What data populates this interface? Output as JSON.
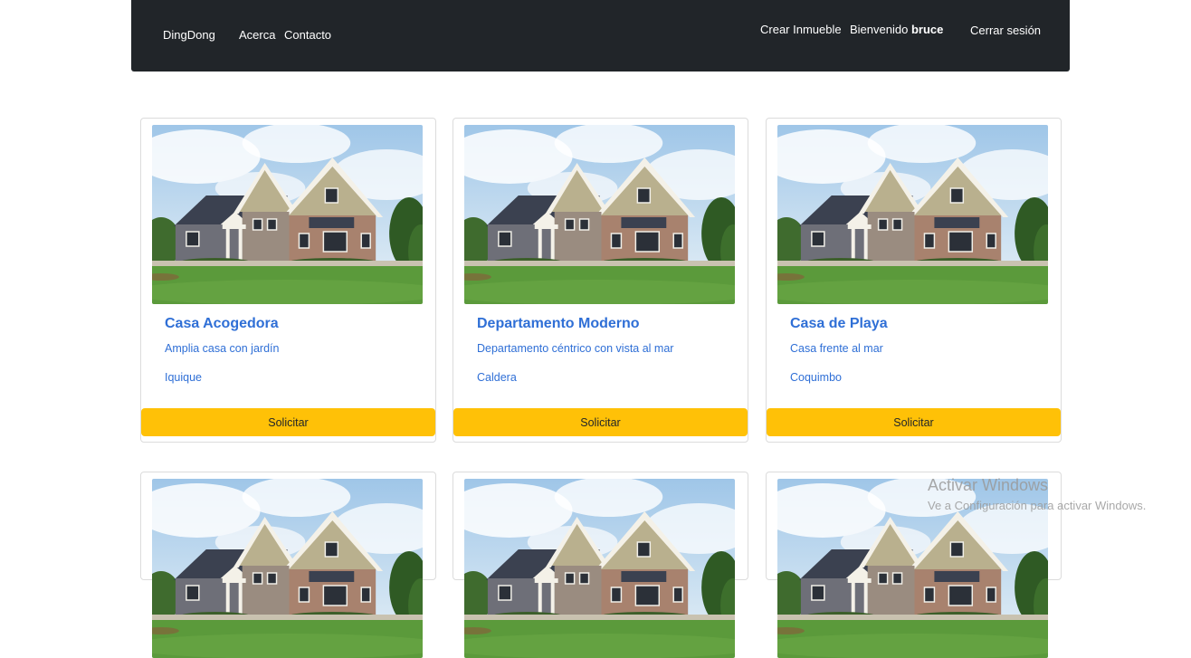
{
  "navbar": {
    "brand": "DingDong",
    "links": [
      "Acerca",
      "Contacto"
    ],
    "create_label": "Crear Inmueble",
    "welcome_prefix": "Bienvenido",
    "username": "bruce",
    "logout_label": "Cerrar sesión"
  },
  "listings": [
    {
      "title": "Casa Acogedora",
      "description": "Amplia casa con jardín",
      "city": "Iquique",
      "button": "Solicitar"
    },
    {
      "title": "Departamento Moderno",
      "description": "Departamento céntrico con vista al mar",
      "city": "Caldera",
      "button": "Solicitar"
    },
    {
      "title": "Casa de Playa",
      "description": "Casa frente al mar",
      "city": "Coquimbo",
      "button": "Solicitar"
    }
  ],
  "watermark": {
    "title": "Activar Windows",
    "subtitle": "Ve a Configuración para activar Windows."
  },
  "colors": {
    "navbar_bg": "#212529",
    "link": "#2f6fd6",
    "button": "#ffc107"
  }
}
